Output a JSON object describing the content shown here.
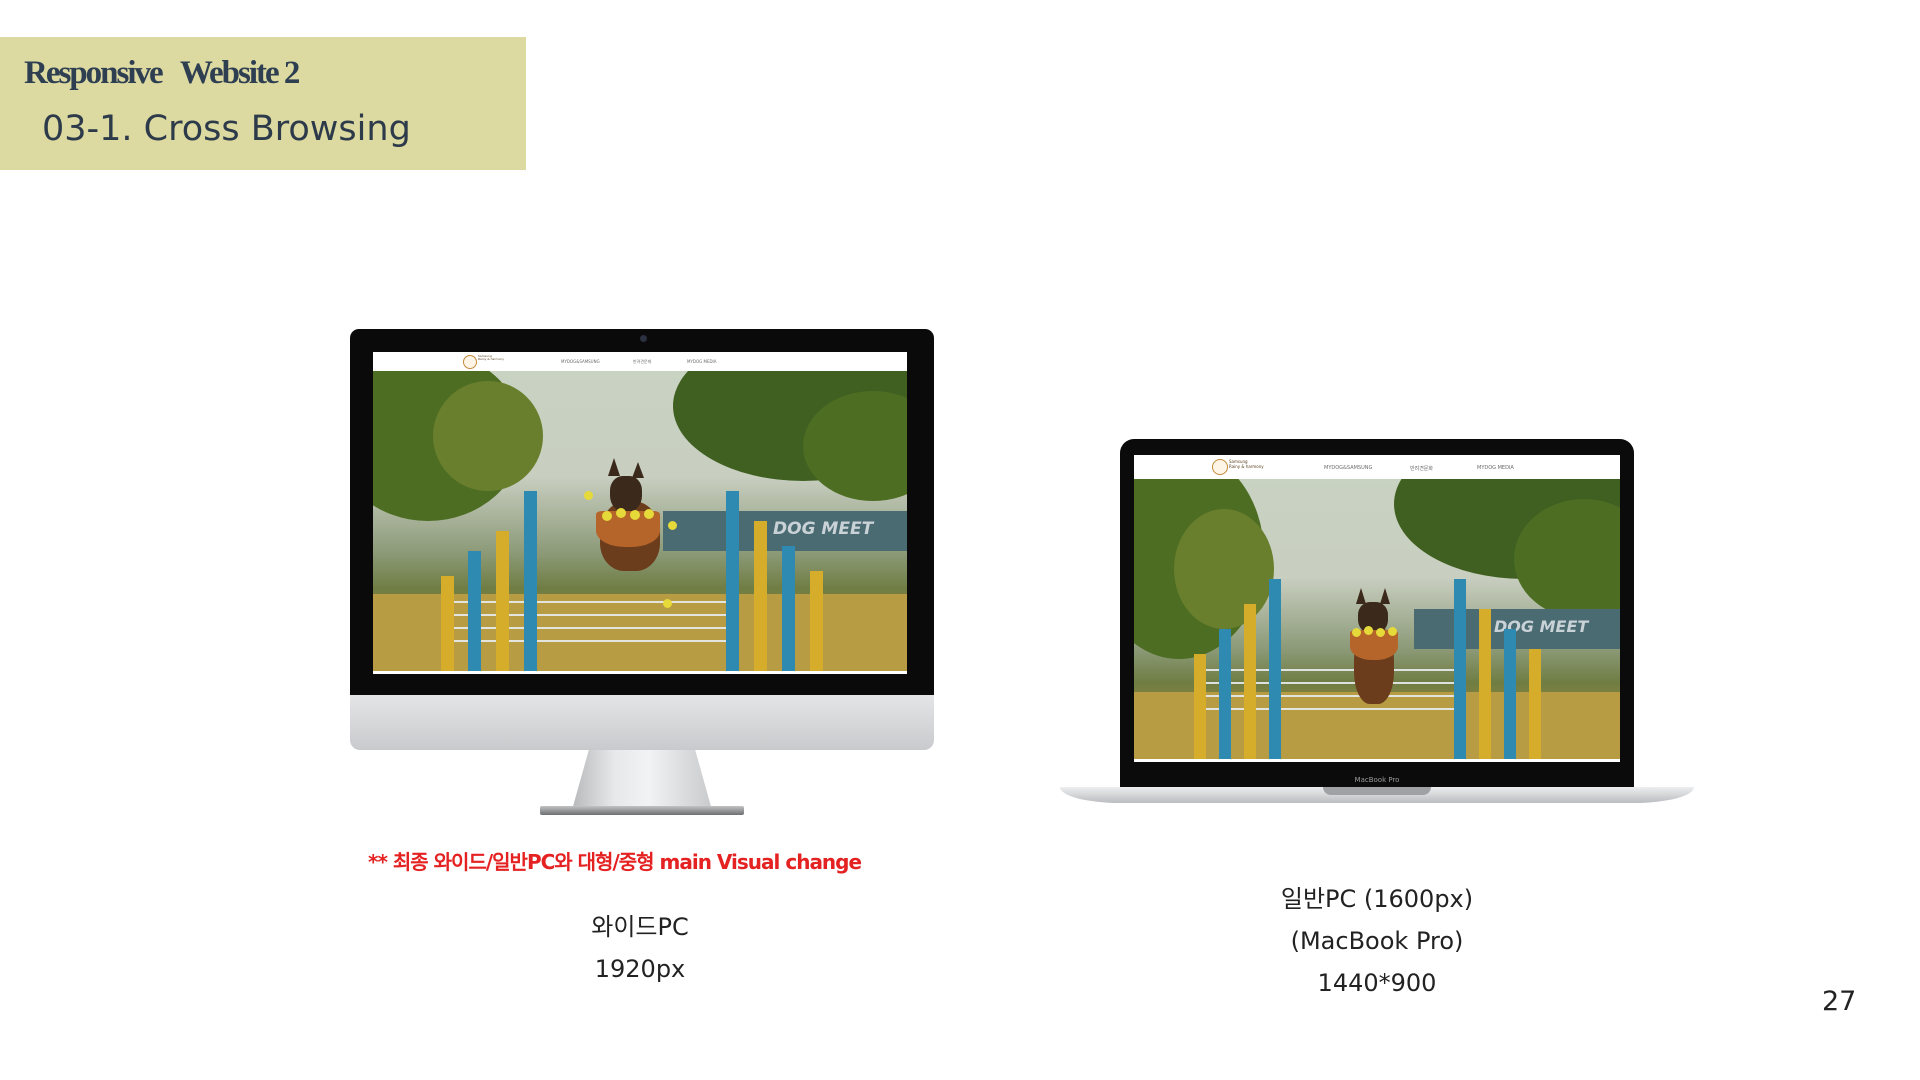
{
  "header": {
    "title": "Responsive   Website 2",
    "subtitle": "03-1. Cross Browsing"
  },
  "site_preview": {
    "logo_line1": "Samsung",
    "logo_line2": "Rainy & harmony",
    "menu": [
      "MYDOG&SAMSUNG",
      "반려견문화",
      "MYDOG MEDIA"
    ],
    "banner_text": "DOG MEET"
  },
  "note": "** 최종 와이드/일반PC와 대형/중형 main Visual change",
  "devices": {
    "wide": {
      "lines": [
        "와이드PC",
        "1920px"
      ]
    },
    "laptop": {
      "label": "MacBook Pro",
      "lines": [
        "일반PC (1600px)",
        "(MacBook Pro)",
        "1440*900"
      ]
    }
  },
  "page_number": "27",
  "colors": {
    "title_band": "#dcd9a1",
    "title_text": "#2f3f52",
    "note_red": "#e52222",
    "post_blue": "#2e8ab0",
    "post_yellow": "#d6ad2a"
  }
}
